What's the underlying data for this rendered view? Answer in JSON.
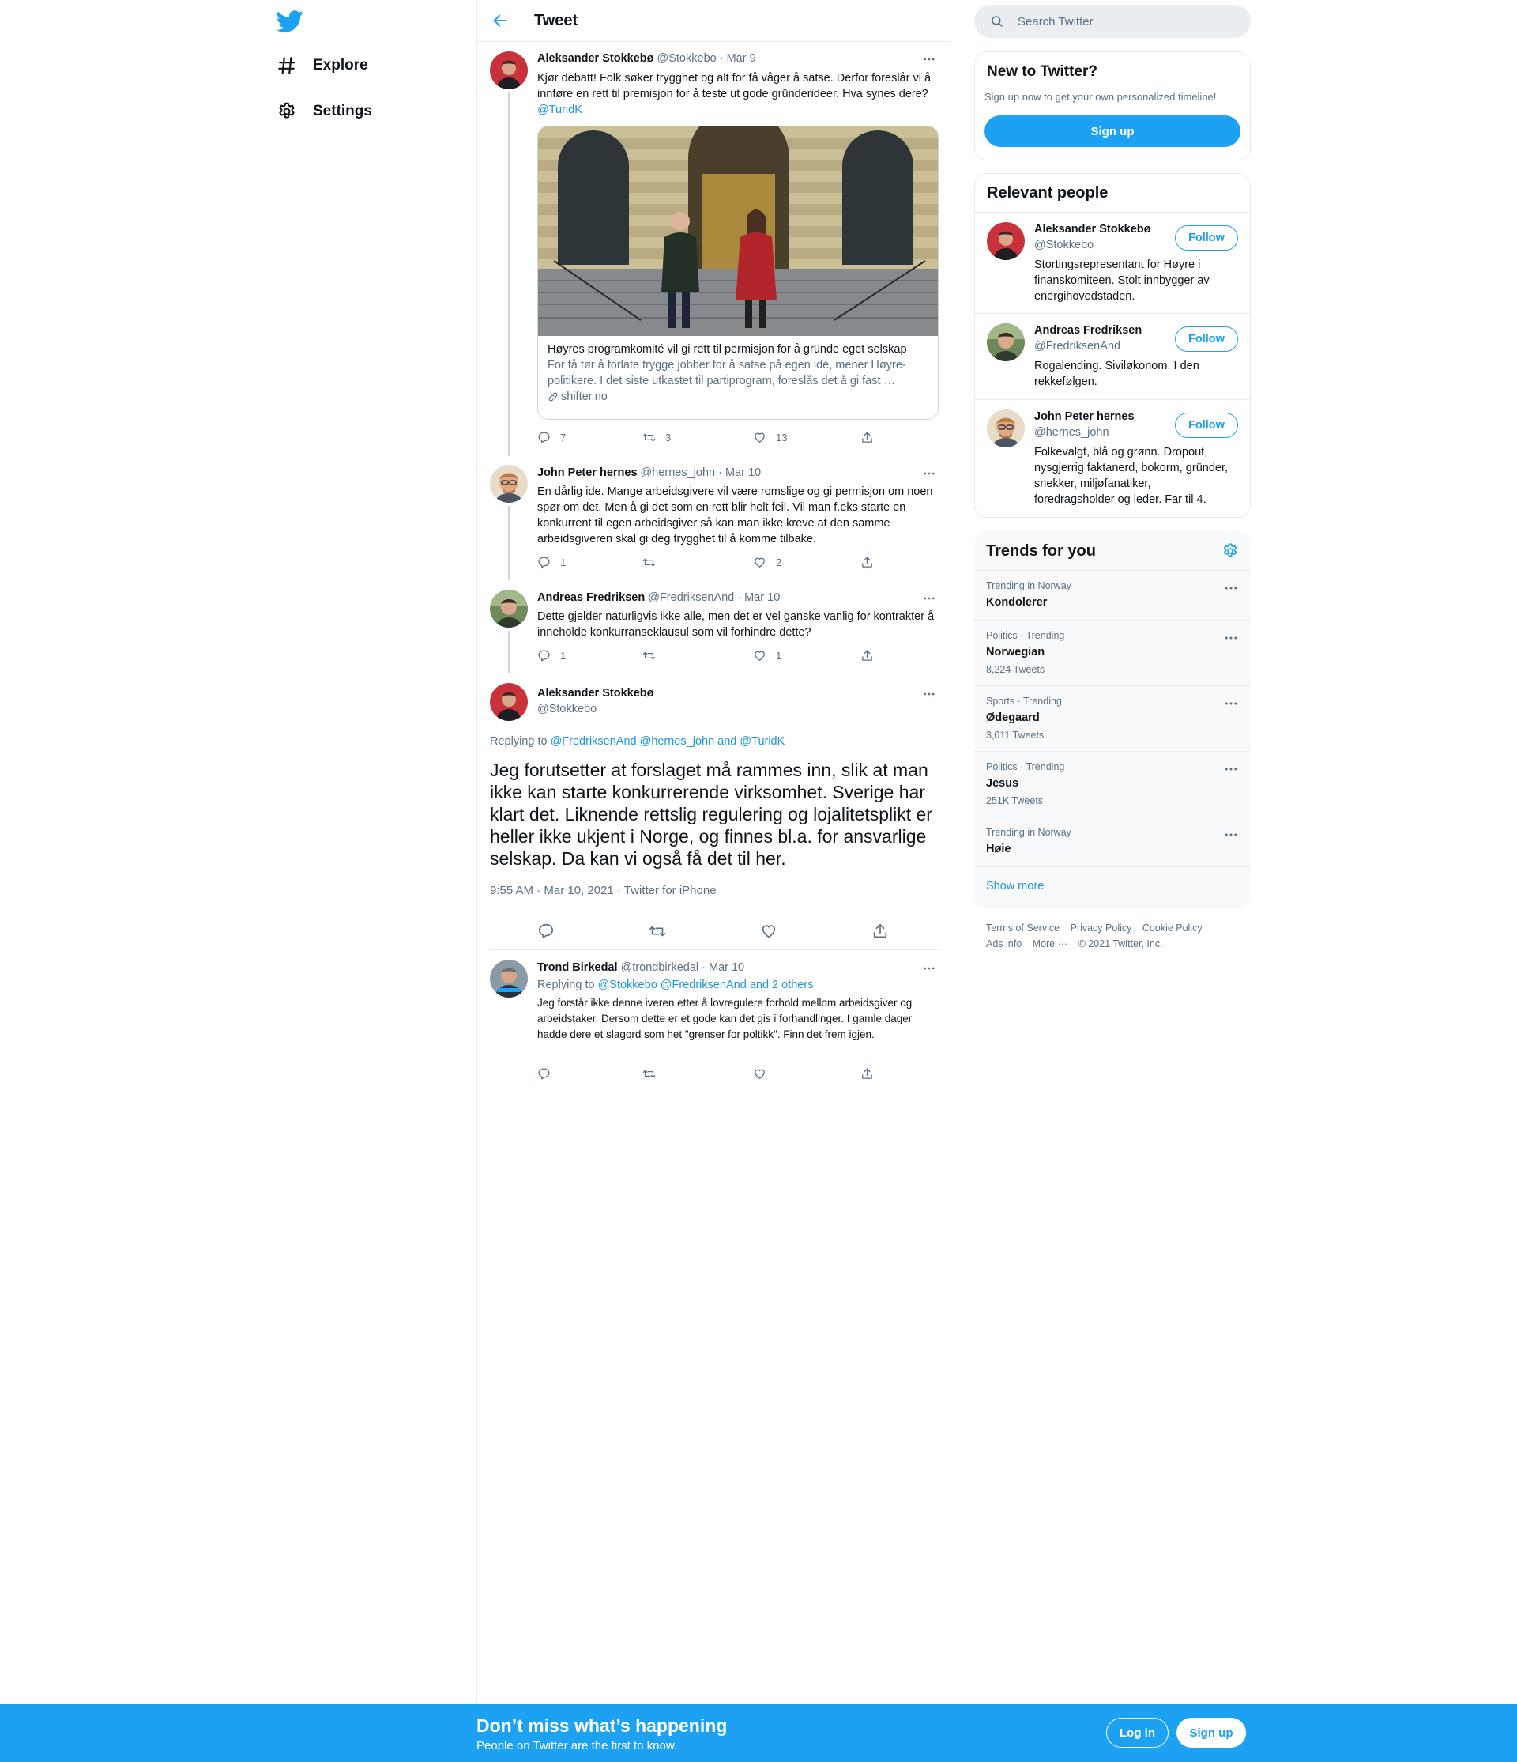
{
  "colors": {
    "accent": "#1da1f2",
    "link": "#1b95e0",
    "muted": "#5b7083",
    "border": "#e6ecf0"
  },
  "nav": {
    "logo_icon": "twitter-bird-icon",
    "items": [
      {
        "label": "Explore",
        "icon": "hashtag-icon"
      },
      {
        "label": "Settings",
        "icon": "gear-icon"
      }
    ]
  },
  "header": {
    "title": "Tweet",
    "back_icon": "arrow-left-icon"
  },
  "tweets": [
    {
      "name": "Aleksander Stokkebø",
      "meta": "@Stokkebo · Mar 9",
      "text": "Kjør debatt! Folk søker trygghet og alt for få våger å satse. Derfor foreslår vi å innføre en rett til premisjon for å teste ut gode gründerideer. Hva synes dere?",
      "mention": "@TuridK",
      "card": {
        "title": "Høyres programkomité vil gi rett til permisjon for å gründe eget selskap",
        "description": "For få tør å forlate trygge jobber for å satse på egen idé, mener Høyre-politikere. I det siste utkastet til partiprogram, foreslås det å gi fast …",
        "domain": "shifter.no"
      },
      "replies": "7",
      "retweets": "3",
      "likes": "13"
    },
    {
      "name": "John Peter hernes",
      "meta": "@hernes_john · Mar 10",
      "text": "En dårlig ide. Mange arbeidsgivere vil være romslige og gi permisjon om noen spør om det. Men å gi det som en rett blir helt feil. Vil man f.eks starte en konkurrent til egen arbeidsgiver så kan man ikke kreve at den samme arbeidsgiveren skal gi deg trygghet til å komme tilbake.",
      "replies": "1",
      "retweets": "",
      "likes": "2"
    },
    {
      "name": "Andreas Fredriksen",
      "meta": "@FredriksenAnd · Mar 10",
      "text": "Dette gjelder naturligvis ikke alle, men det er vel ganske vanlig for kontrakter å inneholde konkurranseklausul som vil forhindre dette?",
      "replies": "1",
      "retweets": "",
      "likes": "1"
    }
  ],
  "main_tweet": {
    "name": "Aleksander Stokkebø",
    "handle": "@Stokkebo",
    "replying_prefix": "Replying to",
    "replying_to": "@FredriksenAnd @hernes_john and @TuridK",
    "text": "Jeg forutsetter at forslaget må rammes inn, slik at man ikke kan starte konkurrerende virksomhet. Sverige har klart det. Liknende rettslig regulering og lojalitetsplikt er heller ikke ukjent i Norge, og finnes bl.a. for ansvarlige selskap. Da kan vi også få det til her.",
    "timestamp": "9:55 AM · Mar 10, 2021 · Twitter for iPhone"
  },
  "reply_tweet": {
    "name": "Trond Birkedal",
    "meta": "@trondbirkedal · Mar 10",
    "replying_prefix": "Replying to",
    "replying_to": "@Stokkebo @FredriksenAnd and 2 others",
    "text": "Jeg forstår ikke denne iveren etter å lovregulere forhold mellom arbeidsgiver og arbeidstaker. Dersom dette er et gode kan det gis i forhandlinger. I gamle dager hadde dere et slagord som het \"grenser for poltikk\". Finn det frem igjen.",
    "replies": "",
    "retweets": "",
    "likes": ""
  },
  "search": {
    "placeholder": "Search Twitter"
  },
  "signup_box": {
    "title": "New to Twitter?",
    "description": "Sign up now to get your own personalized timeline!",
    "button": "Sign up"
  },
  "relevant_people": {
    "title": "Relevant people",
    "follow_label": "Follow",
    "people": [
      {
        "name": "Aleksander Stokkebø",
        "handle": "@Stokkebo",
        "bio": "Stortingsrepresentant for Høyre i finanskomiteen. Stolt innbygger av energihovedstaden."
      },
      {
        "name": "Andreas Fredriksen",
        "handle": "@FredriksenAnd",
        "bio": "Rogalending. Siviløkonom. I den rekkefølgen."
      },
      {
        "name": "John Peter hernes",
        "handle": "@hernes_john",
        "bio": "Folkevalgt, blå og grønn. Dropout, nysgjerrig faktanerd, bokorm, gründer, snekker, miljøfanatiker, foredragsholder og leder. Far til 4."
      }
    ]
  },
  "trends": {
    "title": "Trends for you",
    "items": [
      {
        "context": "Trending in Norway",
        "name": "Kondolerer",
        "count": ""
      },
      {
        "context": "Politics · Trending",
        "name": "Norwegian",
        "count": "8,224 Tweets"
      },
      {
        "context": "Sports · Trending",
        "name": "Ødegaard",
        "count": "3,011 Tweets"
      },
      {
        "context": "Politics · Trending",
        "name": "Jesus",
        "count": "251K Tweets"
      },
      {
        "context": "Trending in Norway",
        "name": "Høie",
        "count": ""
      }
    ],
    "show_more": "Show more"
  },
  "footer": {
    "links": [
      "Terms of Service",
      "Privacy Policy",
      "Cookie Policy",
      "Ads info",
      "More ···",
      "© 2021 Twitter, Inc."
    ]
  },
  "bottom_bar": {
    "title": "Don’t miss what’s happening",
    "subtitle": "People on Twitter are the first to know.",
    "login": "Log in",
    "signup": "Sign up"
  }
}
